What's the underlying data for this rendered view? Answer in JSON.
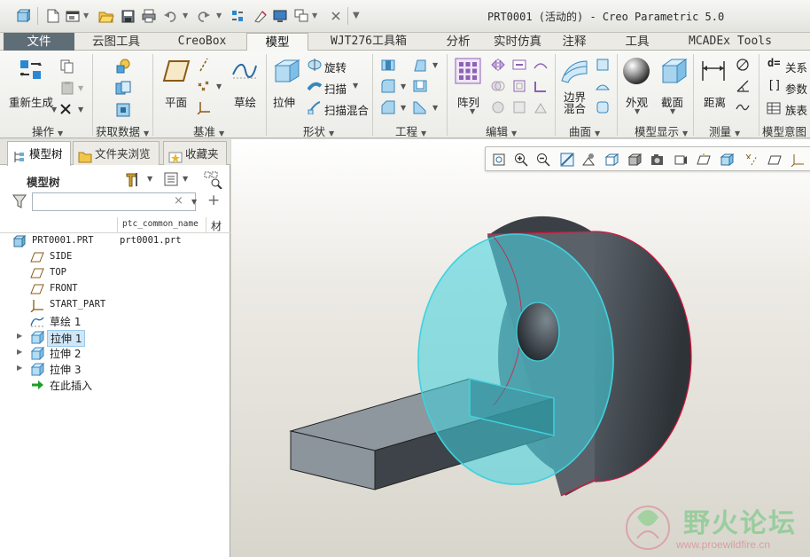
{
  "window": {
    "title": "PRT0001 (活动的) - Creo Parametric 5.0"
  },
  "tabs": [
    "文件",
    "云图工具",
    "CreoBox",
    "模型",
    "WJT276工具箱",
    "分析",
    "实时仿真",
    "注释",
    "工具",
    "MCADEx Tools"
  ],
  "active_tab": "模型",
  "ribbon": {
    "operations": {
      "regenerate": "重新生成",
      "label": "操作"
    },
    "get_data": {
      "label": "获取数据"
    },
    "datum": {
      "plane": "平面",
      "sketch": "草绘",
      "label": "基准"
    },
    "shapes": {
      "extrude": "拉伸",
      "revolve": "旋转",
      "sweep": "扫描",
      "swept_blend": "扫描混合",
      "label": "形状"
    },
    "engineering": {
      "label": "工程"
    },
    "editing": {
      "pattern": "阵列",
      "label": "编辑"
    },
    "surfaces": {
      "boundary_blend": "边界混合",
      "label": "曲面"
    },
    "model_display": {
      "appearance": "外观",
      "section": "截面",
      "label": "模型显示"
    },
    "measure": {
      "distance": "距离",
      "label": "测量"
    },
    "model_intent": {
      "relations": "关系",
      "parameters": "参数",
      "family_table": "族表",
      "label": "模型意图"
    }
  },
  "panel": {
    "tabs": [
      "模型树",
      "文件夹浏览",
      "收藏夹"
    ],
    "tree_title": "模型树",
    "search_placeholder": "",
    "columns": [
      "ptc_common_name",
      "材"
    ],
    "tree": [
      {
        "label": "PRT0001.PRT",
        "common_name": "prt0001.prt",
        "icon": "part-icon"
      },
      {
        "label": "SIDE",
        "icon": "datum-plane-icon"
      },
      {
        "label": "TOP",
        "icon": "datum-plane-icon"
      },
      {
        "label": "FRONT",
        "icon": "datum-plane-icon"
      },
      {
        "label": "START_PART",
        "icon": "coordinate-system-icon"
      },
      {
        "label": "草绘 1",
        "icon": "sketch-icon"
      },
      {
        "label": "拉伸 1",
        "icon": "extrude-icon",
        "selected": true
      },
      {
        "label": "拉伸 2",
        "icon": "extrude-icon"
      },
      {
        "label": "拉伸 3",
        "icon": "extrude-icon"
      },
      {
        "label": "在此插入",
        "icon": "insert-here-arrow-icon"
      }
    ]
  },
  "watermark": {
    "name": "野火论坛",
    "url": "www.proewildfire.cn"
  },
  "colors": {
    "selection_cyan": "#3fd2de",
    "edge_red": "#d8143c",
    "part_gray": "#5d646b",
    "file_tab": "#5f6d76"
  }
}
